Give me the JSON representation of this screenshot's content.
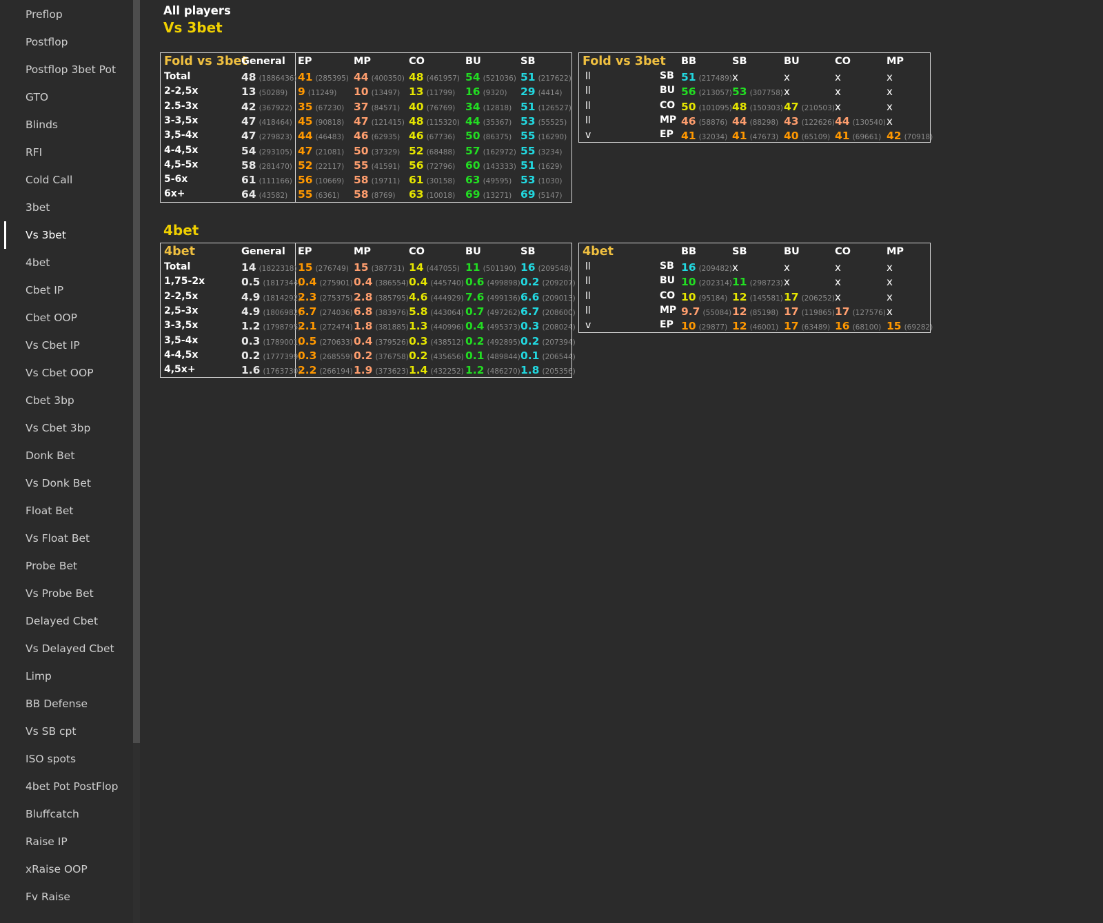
{
  "sidebar": {
    "active_index": 8,
    "items": [
      "Preflop",
      "Postflop",
      "Postflop 3bet Pot",
      "GTO",
      "Blinds",
      "RFI",
      "Cold Call",
      "3bet",
      "Vs 3bet",
      "4bet",
      "Cbet IP",
      "Cbet OOP",
      "Vs Cbet IP",
      "Vs Cbet OOP",
      "Cbet 3bp",
      "Vs Cbet 3bp",
      "Donk Bet",
      "Vs Donk Bet",
      "Float Bet",
      "Vs Float Bet",
      "Probe Bet",
      "Vs Probe Bet",
      "Delayed Cbet",
      "Vs Delayed Cbet",
      "Limp",
      "BB Defense",
      "Vs SB cpt",
      "ISO spots",
      "4bet Pot PostFlop",
      "Bluffcatch",
      "Raise IP",
      "xRaise OOP",
      "Fv Raise"
    ]
  },
  "header": {
    "subtitle": "All players",
    "title": "Vs 3bet"
  },
  "section2_title": "4bet",
  "colors": {
    "white": "#e8e8e8",
    "orange": "#ff9800",
    "salmon": "#ff9e6e",
    "yellow": "#e6e600",
    "green": "#22dd22",
    "cyan": "#22d8e0"
  },
  "tables": [
    {
      "id": "fold-vs-3bet-sizing",
      "title": "Fold vs 3bet",
      "headers": [
        "General",
        "EP",
        "MP",
        "CO",
        "BU",
        "SB"
      ],
      "colors": [
        "white",
        "orange",
        "salmon",
        "yellow",
        "green",
        "cyan"
      ],
      "rows": [
        {
          "label": "Total",
          "cells": [
            [
              "48",
              "(1886436)"
            ],
            [
              "41",
              "(285395)"
            ],
            [
              "44",
              "(400350)"
            ],
            [
              "48",
              "(461957)"
            ],
            [
              "54",
              "(521036)"
            ],
            [
              "51",
              "(217622)"
            ]
          ]
        },
        {
          "label": "2-2,5x",
          "cells": [
            [
              "13",
              "(50289)"
            ],
            [
              "9",
              "(11249)"
            ],
            [
              "10",
              "(13497)"
            ],
            [
              "13",
              "(11799)"
            ],
            [
              "16",
              "(9320)"
            ],
            [
              "29",
              "(4414)"
            ]
          ]
        },
        {
          "label": "2.5-3x",
          "cells": [
            [
              "42",
              "(367922)"
            ],
            [
              "35",
              "(67230)"
            ],
            [
              "37",
              "(84571)"
            ],
            [
              "40",
              "(76769)"
            ],
            [
              "34",
              "(12818)"
            ],
            [
              "51",
              "(126527)"
            ]
          ]
        },
        {
          "label": "3-3,5x",
          "cells": [
            [
              "47",
              "(418464)"
            ],
            [
              "45",
              "(90818)"
            ],
            [
              "47",
              "(121415)"
            ],
            [
              "48",
              "(115320)"
            ],
            [
              "44",
              "(35367)"
            ],
            [
              "53",
              "(55525)"
            ]
          ]
        },
        {
          "label": "3,5-4x",
          "cells": [
            [
              "47",
              "(279823)"
            ],
            [
              "44",
              "(46483)"
            ],
            [
              "46",
              "(62935)"
            ],
            [
              "46",
              "(67736)"
            ],
            [
              "50",
              "(86375)"
            ],
            [
              "55",
              "(16290)"
            ]
          ]
        },
        {
          "label": "4-4,5x",
          "cells": [
            [
              "54",
              "(293105)"
            ],
            [
              "47",
              "(21081)"
            ],
            [
              "50",
              "(37329)"
            ],
            [
              "52",
              "(68488)"
            ],
            [
              "57",
              "(162972)"
            ],
            [
              "55",
              "(3234)"
            ]
          ]
        },
        {
          "label": "4,5-5x",
          "cells": [
            [
              "58",
              "(281470)"
            ],
            [
              "52",
              "(22117)"
            ],
            [
              "55",
              "(41591)"
            ],
            [
              "56",
              "(72796)"
            ],
            [
              "60",
              "(143333)"
            ],
            [
              "51",
              "(1629)"
            ]
          ]
        },
        {
          "label": "5-6x",
          "cells": [
            [
              "61",
              "(111166)"
            ],
            [
              "56",
              "(10669)"
            ],
            [
              "58",
              "(19711)"
            ],
            [
              "61",
              "(30158)"
            ],
            [
              "63",
              "(49595)"
            ],
            [
              "53",
              "(1030)"
            ]
          ]
        },
        {
          "label": "6x+",
          "cells": [
            [
              "64",
              "(43582)"
            ],
            [
              "55",
              "(6361)"
            ],
            [
              "58",
              "(8769)"
            ],
            [
              "63",
              "(10018)"
            ],
            [
              "69",
              "(13271)"
            ],
            [
              "69",
              "(5147)"
            ]
          ]
        }
      ]
    },
    {
      "id": "4bet-sizing",
      "title": "4bet",
      "headers": [
        "General",
        "EP",
        "MP",
        "CO",
        "BU",
        "SB"
      ],
      "colors": [
        "white",
        "orange",
        "salmon",
        "yellow",
        "green",
        "cyan"
      ],
      "rows": [
        {
          "label": "Total",
          "cells": [
            [
              "14",
              "(1822318)"
            ],
            [
              "15",
              "(276749)"
            ],
            [
              "15",
              "(387731)"
            ],
            [
              "14",
              "(447055)"
            ],
            [
              "11",
              "(501190)"
            ],
            [
              "16",
              "(209548)"
            ]
          ]
        },
        {
          "label": "1,75-2x",
          "cells": [
            [
              "0.5",
              "(1817344)"
            ],
            [
              "0.4",
              "(275901)"
            ],
            [
              "0.4",
              "(386554)"
            ],
            [
              "0.4",
              "(445740)"
            ],
            [
              "0.6",
              "(499898)"
            ],
            [
              "0.2",
              "(209207)"
            ]
          ]
        },
        {
          "label": "2-2,5x",
          "cells": [
            [
              "4.9",
              "(1814292)"
            ],
            [
              "2.3",
              "(275375)"
            ],
            [
              "2.8",
              "(385795)"
            ],
            [
              "4.6",
              "(444929)"
            ],
            [
              "7.6",
              "(499136)"
            ],
            [
              "6.6",
              "(209013)"
            ]
          ]
        },
        {
          "label": "2,5-3x",
          "cells": [
            [
              "4.9",
              "(1806982)"
            ],
            [
              "6.7",
              "(274036)"
            ],
            [
              "6.8",
              "(383976)"
            ],
            [
              "5.8",
              "(443064)"
            ],
            [
              "0.7",
              "(497262)"
            ],
            [
              "6.7",
              "(208600)"
            ]
          ]
        },
        {
          "label": "3-3,5x",
          "cells": [
            [
              "1.2",
              "(1798795)"
            ],
            [
              "2.1",
              "(272474)"
            ],
            [
              "1.8",
              "(381885)"
            ],
            [
              "1.3",
              "(440996)"
            ],
            [
              "0.4",
              "(495373)"
            ],
            [
              "0.3",
              "(208024)"
            ]
          ]
        },
        {
          "label": "3,5-4x",
          "cells": [
            [
              "0.3",
              "(1789001)"
            ],
            [
              "0.5",
              "(270633)"
            ],
            [
              "0.4",
              "(379526)"
            ],
            [
              "0.3",
              "(438512)"
            ],
            [
              "0.2",
              "(492895)"
            ],
            [
              "0.2",
              "(207394)"
            ]
          ]
        },
        {
          "label": "4-4,5x",
          "cells": [
            [
              "0.2",
              "(1777399)"
            ],
            [
              "0.3",
              "(268559)"
            ],
            [
              "0.2",
              "(376758)"
            ],
            [
              "0.2",
              "(435656)"
            ],
            [
              "0.1",
              "(489844)"
            ],
            [
              "0.1",
              "(206544)"
            ]
          ]
        },
        {
          "label": "4,5x+",
          "cells": [
            [
              "1.6",
              "(1763730)"
            ],
            [
              "2.2",
              "(266194)"
            ],
            [
              "1.9",
              "(373623)"
            ],
            [
              "1.4",
              "(432252)"
            ],
            [
              "1.2",
              "(486270)"
            ],
            [
              "1.8",
              "(205356)"
            ]
          ]
        }
      ]
    }
  ],
  "matrices": [
    {
      "id": "fold-vs-3bet-matrix",
      "title": "Fold vs 3bet",
      "headers": [
        "BB",
        "SB",
        "BU",
        "CO",
        "MP"
      ],
      "rows": [
        {
          "mark": "ll",
          "pos": "SB",
          "cells": [
            [
              "51",
              "(217489)",
              "cyan"
            ],
            [
              "x",
              "",
              ""
            ],
            [
              "x",
              "",
              ""
            ],
            [
              "x",
              "",
              ""
            ],
            [
              "x",
              "",
              ""
            ]
          ]
        },
        {
          "mark": "ll",
          "pos": "BU",
          "cells": [
            [
              "56",
              "(213057)",
              "green"
            ],
            [
              "53",
              "(307758)",
              "green"
            ],
            [
              "x",
              "",
              ""
            ],
            [
              "x",
              "",
              ""
            ],
            [
              "x",
              "",
              ""
            ]
          ]
        },
        {
          "mark": "ll",
          "pos": "CO",
          "cells": [
            [
              "50",
              "(101095)",
              "yellow"
            ],
            [
              "48",
              "(150303)",
              "yellow"
            ],
            [
              "47",
              "(210503)",
              "yellow"
            ],
            [
              "x",
              "",
              ""
            ],
            [
              "x",
              "",
              ""
            ]
          ]
        },
        {
          "mark": "ll",
          "pos": "MP",
          "cells": [
            [
              "46",
              "(58876)",
              "salmon"
            ],
            [
              "44",
              "(88298)",
              "salmon"
            ],
            [
              "43",
              "(122626)",
              "salmon"
            ],
            [
              "44",
              "(130540)",
              "salmon"
            ],
            [
              "x",
              "",
              ""
            ]
          ]
        },
        {
          "mark": "v",
          "pos": "EP",
          "cells": [
            [
              "41",
              "(32034)",
              "orange"
            ],
            [
              "41",
              "(47673)",
              "orange"
            ],
            [
              "40",
              "(65109)",
              "orange"
            ],
            [
              "41",
              "(69661)",
              "orange"
            ],
            [
              "42",
              "(70918)",
              "orange"
            ]
          ]
        }
      ]
    },
    {
      "id": "4bet-matrix",
      "title": "4bet",
      "headers": [
        "BB",
        "SB",
        "BU",
        "CO",
        "MP"
      ],
      "rows": [
        {
          "mark": "ll",
          "pos": "SB",
          "cells": [
            [
              "16",
              "(209482)",
              "cyan"
            ],
            [
              "x",
              "",
              ""
            ],
            [
              "x",
              "",
              ""
            ],
            [
              "x",
              "",
              ""
            ],
            [
              "x",
              "",
              ""
            ]
          ]
        },
        {
          "mark": "ll",
          "pos": "BU",
          "cells": [
            [
              "10",
              "(202314)",
              "green"
            ],
            [
              "11",
              "(298723)",
              "green"
            ],
            [
              "x",
              "",
              ""
            ],
            [
              "x",
              "",
              ""
            ],
            [
              "x",
              "",
              ""
            ]
          ]
        },
        {
          "mark": "ll",
          "pos": "CO",
          "cells": [
            [
              "10",
              "(95184)",
              "yellow"
            ],
            [
              "12",
              "(145581)",
              "yellow"
            ],
            [
              "17",
              "(206252)",
              "yellow"
            ],
            [
              "x",
              "",
              ""
            ],
            [
              "x",
              "",
              ""
            ]
          ]
        },
        {
          "mark": "ll",
          "pos": "MP",
          "cells": [
            [
              "9.7",
              "(55084)",
              "salmon"
            ],
            [
              "12",
              "(85198)",
              "salmon"
            ],
            [
              "17",
              "(119865)",
              "salmon"
            ],
            [
              "17",
              "(127576)",
              "salmon"
            ],
            [
              "x",
              "",
              ""
            ]
          ]
        },
        {
          "mark": "v",
          "pos": "EP",
          "cells": [
            [
              "10",
              "(29877)",
              "orange"
            ],
            [
              "12",
              "(46001)",
              "orange"
            ],
            [
              "17",
              "(63489)",
              "orange"
            ],
            [
              "16",
              "(68100)",
              "orange"
            ],
            [
              "15",
              "(69282)",
              "orange"
            ]
          ]
        }
      ]
    }
  ]
}
